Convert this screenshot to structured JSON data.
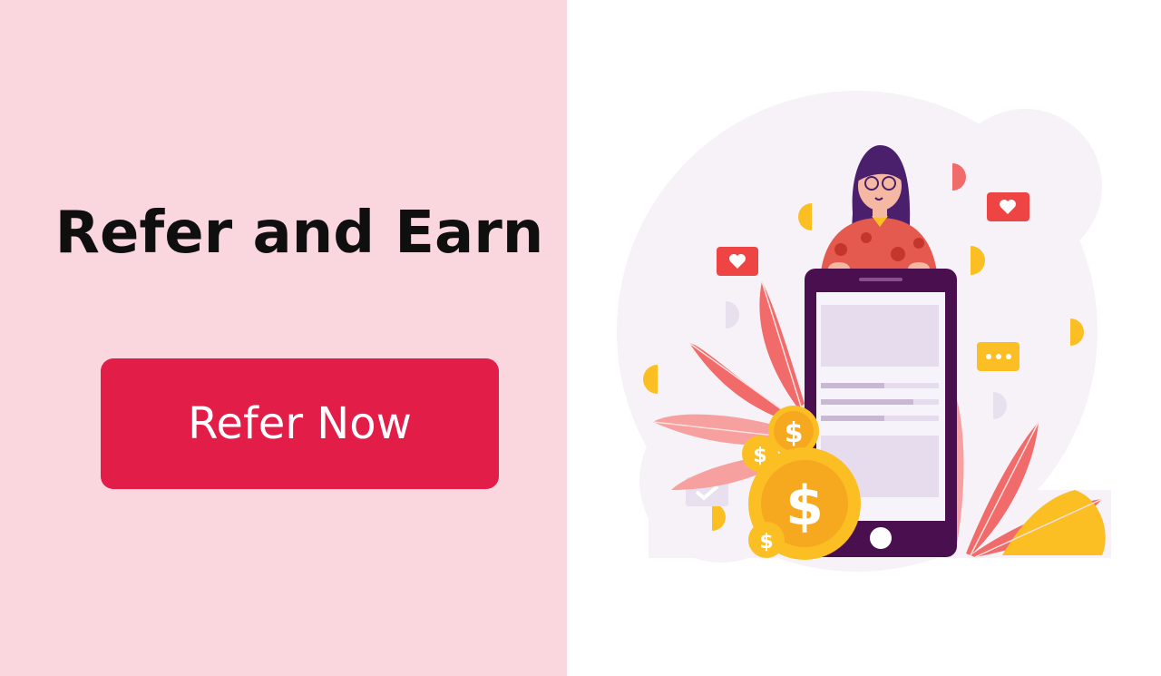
{
  "hero": {
    "title": "Refer and Earn",
    "cta_label": "Refer Now"
  },
  "illustration": {
    "coin_symbol": "$",
    "icon_names": [
      "woman-figure",
      "smartphone-icon",
      "heart-chat-icon",
      "ellipsis-chat-icon",
      "dollar-coin-icon",
      "leaf-icon",
      "checkmark-icon"
    ]
  },
  "colors": {
    "left_panel_bg": "#fad6de",
    "button_bg": "#e11d48",
    "button_text": "#ffffff",
    "title_text": "#0f0f0f",
    "phone_frame": "#4a0f4f",
    "coin": "#fbbf24",
    "leaf": "#f16b6b"
  }
}
